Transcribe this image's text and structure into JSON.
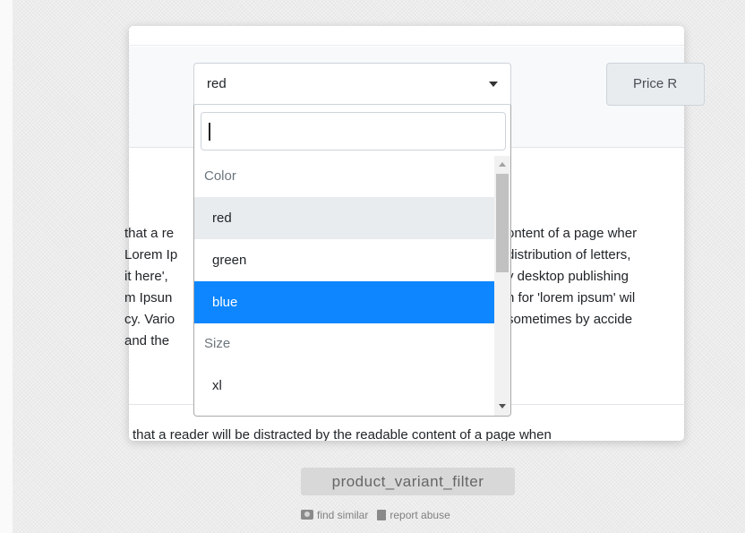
{
  "filter": {
    "selected_value": "red",
    "price_button_label": "Price R",
    "search_value": "",
    "options": [
      {
        "type": "group",
        "label": "Color"
      },
      {
        "type": "option",
        "label": "red",
        "state": "selected"
      },
      {
        "type": "option",
        "label": "green",
        "state": "normal"
      },
      {
        "type": "option",
        "label": "blue",
        "state": "highlighted"
      },
      {
        "type": "group",
        "label": "Size"
      },
      {
        "type": "option",
        "label": "xl",
        "state": "normal"
      }
    ]
  },
  "content": {
    "lines_left": [
      "that a re",
      "Lorem Ip",
      "it here',",
      "m Ipsun",
      "cy. Vario",
      "and the"
    ],
    "lines_right": [
      "ontent of a page wher",
      "distribution of letters,",
      "y desktop publishing",
      "n for 'lorem ipsum' wil",
      "sometimes by accide",
      ""
    ],
    "faded_line": "that a reader will be distracted by the readable content of a page when"
  },
  "footer": {
    "caption": "product_variant_filter",
    "find_similar": "find similar",
    "report_abuse": "report abuse"
  },
  "colors": {
    "highlight": "#0d86ff",
    "selected_bg": "#e9ecef",
    "caption_bg": "#d8d8d8"
  },
  "icons": [
    "caret-down-icon",
    "camera-icon",
    "clipboard-icon"
  ]
}
